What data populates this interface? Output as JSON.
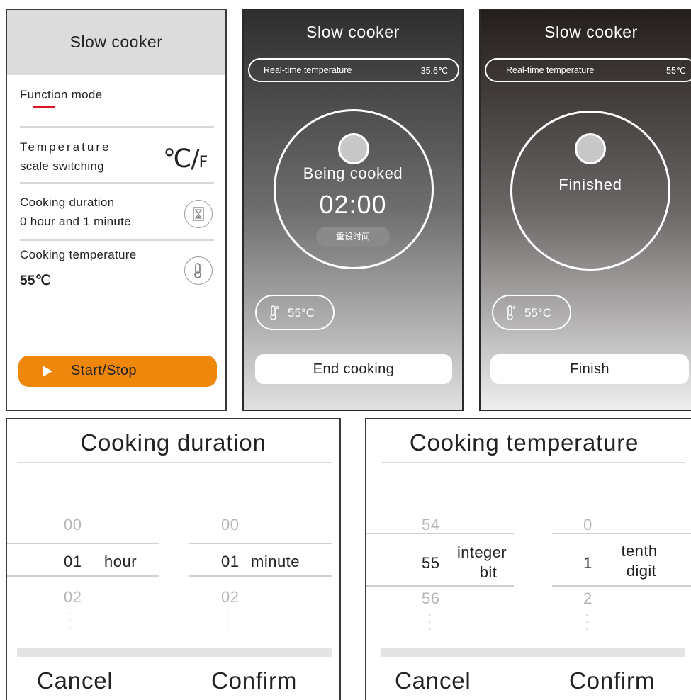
{
  "screens": {
    "function_screen": {
      "title": "Slow cooker",
      "function_mode": "Function mode",
      "temp_scale": {
        "line1": "Temperature",
        "line2": "scale switching",
        "symbol_c": "℃/",
        "symbol_f": "F"
      },
      "cooking_duration": {
        "label": "Cooking duration",
        "value": "0 hour and 1 minute",
        "icon": "hourglass-icon"
      },
      "cooking_temperature": {
        "label": "Cooking temperature",
        "value": "55℃",
        "icon": "thermometer-icon"
      },
      "start_button": "Start/Stop",
      "accent_color": "#f0870d"
    },
    "cooking_screen": {
      "title": "Slow cooker",
      "realtime_label": "Real-time temperature",
      "realtime_value": "35.6℃",
      "status": "Being cooked",
      "timer": "02:00",
      "reset_button": "重设时间",
      "temp_setting": "55°C",
      "end_button": "End cooking"
    },
    "finished_screen": {
      "title": "Slow cooker",
      "realtime_label": "Real-time temperature",
      "realtime_value": "55℃",
      "status": "Finished",
      "temp_setting": "55°C",
      "finish_button": "Finish"
    },
    "duration_dialog": {
      "title": "Cooking duration",
      "hour_wheel": {
        "above": "00",
        "selected": "01",
        "below": "02",
        "unit": "hour"
      },
      "minute_wheel": {
        "above": "00",
        "selected": "01",
        "below": "02",
        "unit": "minute"
      },
      "cancel": "Cancel",
      "confirm": "Confirm"
    },
    "temperature_dialog": {
      "title": "Cooking temperature",
      "integer_wheel": {
        "above": "54",
        "selected": "55",
        "below": "56",
        "unit_line1": "integer",
        "unit_line2": "bit"
      },
      "tenth_wheel": {
        "above": "0",
        "selected": "1",
        "below": "2",
        "unit_line1": "tenth",
        "unit_line2": "digit"
      },
      "cancel": "Cancel",
      "confirm": "Confirm"
    }
  }
}
